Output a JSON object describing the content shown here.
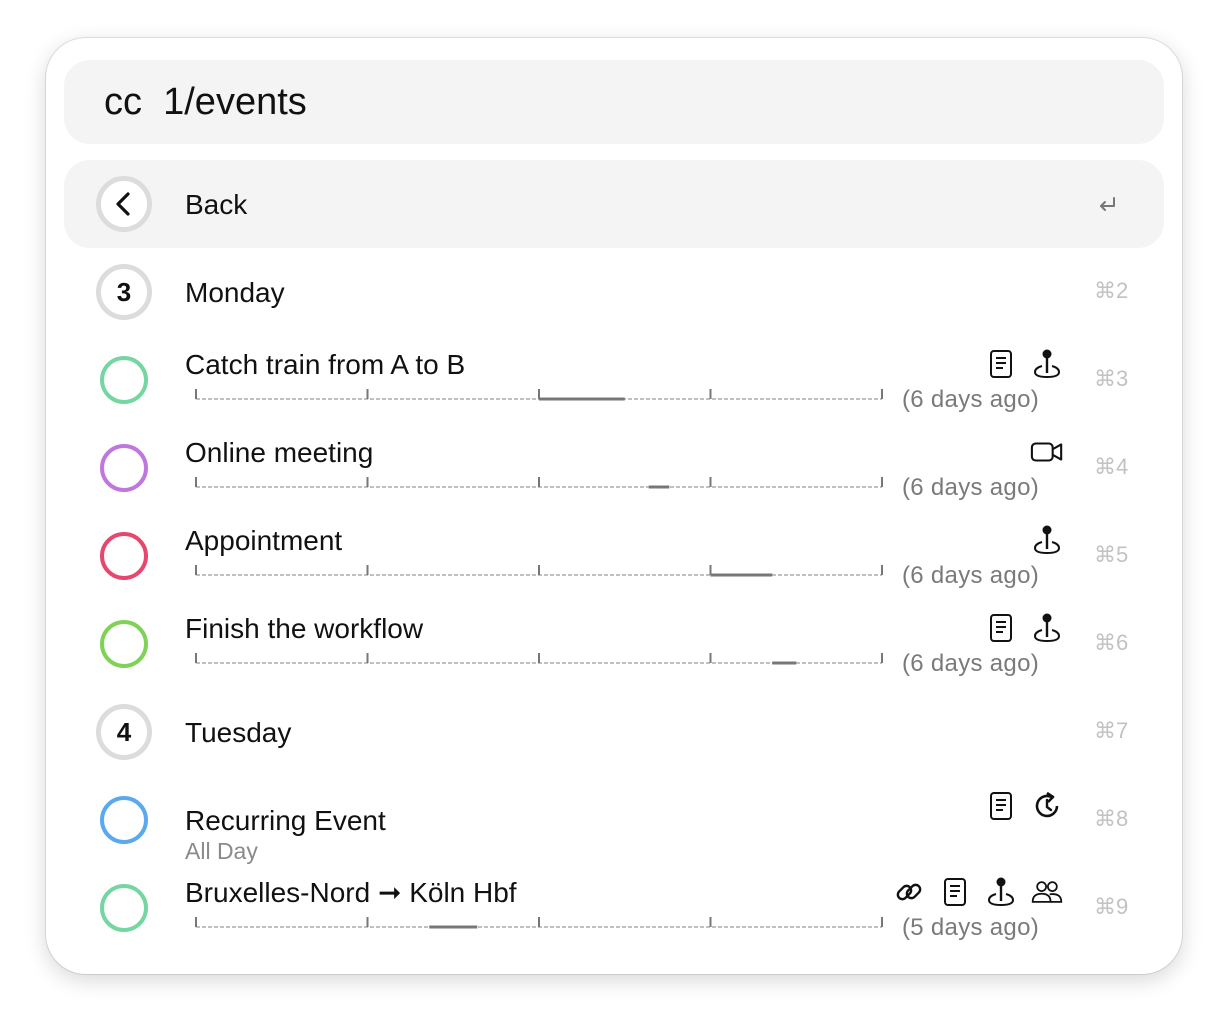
{
  "search": {
    "value": "cc  1/events"
  },
  "back": {
    "label": "Back",
    "shortcut_icon": "return-icon"
  },
  "rows": [
    {
      "type": "header",
      "number": "3",
      "label": "Monday",
      "shortcut": "⌘2"
    },
    {
      "type": "event",
      "label": "Catch train from A to B",
      "color": "#74d6a0",
      "icons": [
        "note-icon",
        "location-pin-icon"
      ],
      "ago": "(6 days ago)",
      "shortcut": "⌘3",
      "bar": [
        0.5,
        0.625
      ]
    },
    {
      "type": "event",
      "label": "Online meeting",
      "color": "#c077dd",
      "icons": [
        "video-camera-icon"
      ],
      "ago": "(6 days ago)",
      "shortcut": "⌘4",
      "bar": [
        0.66,
        0.69
      ]
    },
    {
      "type": "event",
      "label": "Appointment",
      "color": "#e5486c",
      "icons": [
        "location-pin-icon"
      ],
      "ago": "(6 days ago)",
      "shortcut": "⌘5",
      "bar": [
        0.75,
        0.84
      ]
    },
    {
      "type": "event",
      "label": "Finish the workflow",
      "color": "#7ed255",
      "icons": [
        "note-icon",
        "location-pin-icon"
      ],
      "ago": "(6 days ago)",
      "shortcut": "⌘6",
      "bar": [
        0.84,
        0.875
      ]
    },
    {
      "type": "header",
      "number": "4",
      "label": "Tuesday",
      "shortcut": "⌘7"
    },
    {
      "type": "allday",
      "label": "Recurring Event",
      "subtitle": "All Day",
      "color": "#5aa9ee",
      "icons": [
        "note-icon",
        "recurring-icon"
      ],
      "shortcut": "⌘8"
    },
    {
      "type": "event",
      "label": "Bruxelles-Nord ➞ Köln Hbf",
      "color": "#74d6a0",
      "icons": [
        "link-icon",
        "note-icon",
        "location-pin-icon",
        "people-icon"
      ],
      "ago": "(5 days ago)",
      "shortcut": "⌘9",
      "bar": [
        0.34,
        0.41
      ]
    }
  ]
}
